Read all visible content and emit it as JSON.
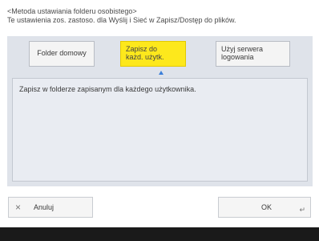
{
  "header": {
    "title": "<Metoda ustawiania folderu osobistego>",
    "subtitle": "Te ustawienia zos. zastoso. dla Wyślij i Sieć w Zapisz/Dostęp do plików."
  },
  "options": [
    {
      "label_line1": "Folder domowy",
      "label_line2": "",
      "selected": false
    },
    {
      "label_line1": "Zapisz do",
      "label_line2": "każd. użytk.",
      "selected": true
    },
    {
      "label_line1": "Użyj serwera",
      "label_line2": "logowania",
      "selected": false
    }
  ],
  "description": "Zapisz w folderze zapisanym dla każdego użytkownika.",
  "buttons": {
    "cancel_label": "Anuluj",
    "cancel_icon": "×",
    "ok_label": "OK",
    "ok_icon": "↵"
  },
  "colors": {
    "selected": "#fde81c",
    "panel": "#dfe3ea",
    "indicator": "#3b7fd9"
  }
}
